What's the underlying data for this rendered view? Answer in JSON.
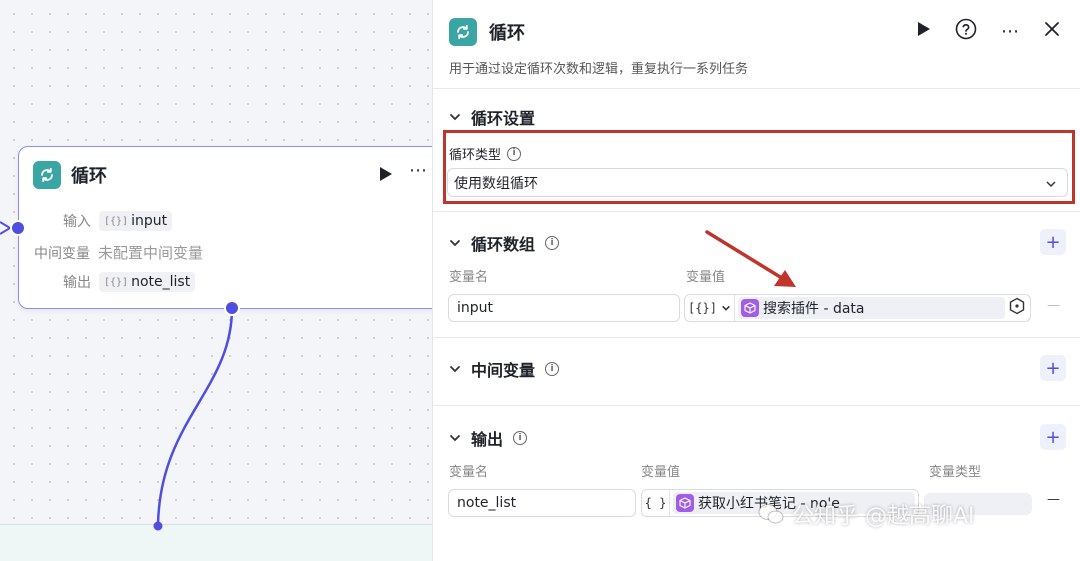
{
  "node": {
    "title": "循环",
    "rows": [
      {
        "key": "输入",
        "type_glyph": "[{}]",
        "value": "input"
      },
      {
        "key": "中间变量",
        "value": "未配置中间变量"
      },
      {
        "key": "输出",
        "type_glyph": "[{}]",
        "value": "note_list"
      }
    ]
  },
  "panel": {
    "title": "循环",
    "description": "用于通过设定循环次数和逻辑，重复执行一系列任务",
    "loop_settings": {
      "title": "循环设置",
      "type_label": "循环类型",
      "type_value": "使用数组循环"
    },
    "loop_array": {
      "title": "循环数组",
      "name_header": "变量名",
      "value_header": "变量值",
      "name_value": "input",
      "type_glyph": "[{}]",
      "ref_value": "搜索插件 - data",
      "remove": "—"
    },
    "intermediate": {
      "title": "中间变量"
    },
    "output": {
      "title": "输出",
      "name_header": "变量名",
      "value_header": "变量值",
      "type_header": "变量类型",
      "name_value": "note_list",
      "type_glyph": "{ }",
      "ref_value": "获取小红书笔记 - no'e",
      "remove": "—"
    },
    "plus": "+"
  },
  "watermark": "公知乎 @越高聊AI",
  "colors": {
    "accent": "#4e4fe0",
    "node_icon": "#3ba5a3",
    "plugin_icon": "#a35ce8",
    "highlight": "#c0352b"
  },
  "icons": [
    "loop-icon",
    "play-icon",
    "help-icon",
    "more-icon",
    "close-icon",
    "chevron-down-icon",
    "info-icon",
    "plus-icon",
    "plugin-icon"
  ]
}
